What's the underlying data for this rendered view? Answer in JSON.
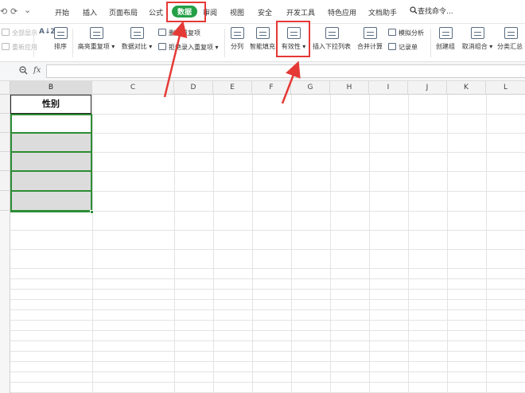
{
  "menubar": {
    "quick_access": [
      "⟲",
      "⟳",
      "⌄"
    ],
    "items": [
      "开始",
      "插入",
      "页面布局",
      "公式",
      "数据",
      "审阅",
      "视图",
      "安全",
      "开发工具",
      "特色应用",
      "文档助手"
    ],
    "active_item": "数据",
    "search_label": "查找命令..."
  },
  "ribbon": {
    "show_all": "全部显示",
    "reapply": "重新应用",
    "sort_icon": "A↓Z",
    "sort": "排序",
    "highlight_dup": "高亮重复项",
    "compare": "数据对比",
    "delete_dup": "删除重复项",
    "reject_dup": "拒绝录入重复项",
    "split": "分列",
    "smart_fill": "智能填充",
    "validity": "有效性",
    "dropdown_list": "插入下拉列表",
    "consolidate": "合并计算",
    "simulate": "模拟分析",
    "record_form": "记录单",
    "group": "创建组",
    "ungroup": "取消组合",
    "subtotal": "分类汇总"
  },
  "formula_bar": {
    "fx": "fx",
    "value": ""
  },
  "sheet": {
    "columns": [
      "B",
      "C",
      "D",
      "E",
      "F",
      "G",
      "H",
      "I",
      "J",
      "K",
      "L"
    ],
    "selected_column": "B",
    "header_cell": "性别"
  },
  "colors": {
    "accent_green": "#23a046",
    "annotation_red": "#e53935",
    "selection_green": "#2d8c35"
  }
}
